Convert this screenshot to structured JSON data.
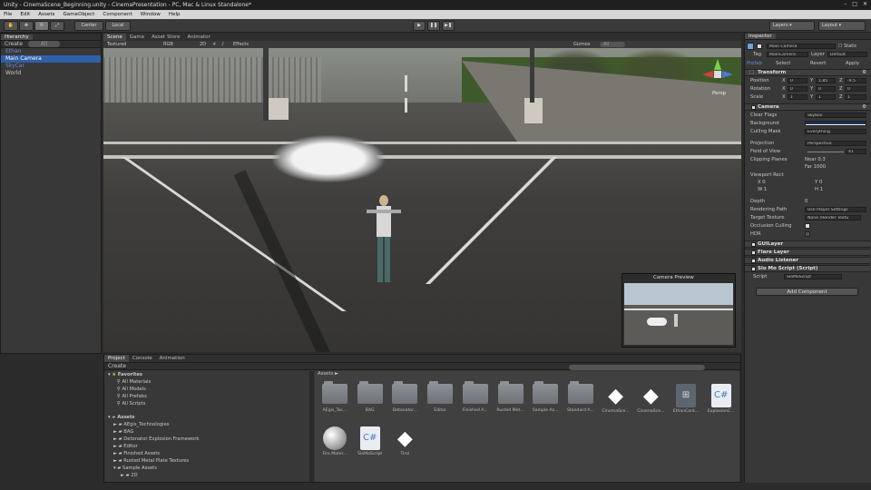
{
  "window": {
    "title": "Unity - CinemaScene_Beginning.unity - CinemaPresentation - PC, Mac & Linux Standalone*",
    "buttons": [
      "–",
      "□",
      "✕"
    ]
  },
  "menu": [
    "File",
    "Edit",
    "Assets",
    "GameObject",
    "Component",
    "Window",
    "Help"
  ],
  "toolbar": {
    "center": "Center",
    "local": "Local",
    "layers": "Layers",
    "layout": "Layout"
  },
  "hierarchy": {
    "tab": "Hierarchy",
    "create": "Create",
    "search": "All",
    "items": [
      {
        "label": "Ethan",
        "type": "prefab"
      },
      {
        "label": "Main Camera",
        "type": "selected"
      },
      {
        "label": "SkyCar",
        "type": "prefab"
      },
      {
        "label": "World",
        "type": "normal"
      }
    ]
  },
  "scene": {
    "tabs": [
      "Scene",
      "Game",
      "Asset Store",
      "Animator"
    ],
    "shading": "Textured",
    "mode": "RGB",
    "dim": "2D",
    "effects": "Effects",
    "gizmos": "Gizmos",
    "gizmo_search": "All",
    "persp": "Persp",
    "preview_title": "Camera Preview"
  },
  "project": {
    "tabs": [
      "Project",
      "Console",
      "Animation"
    ],
    "create": "Create",
    "favorites": "Favorites",
    "fav_items": [
      "All Materials",
      "All Models",
      "All Prefabs",
      "All Scripts"
    ],
    "assets_root": "Assets",
    "tree": [
      "AEgis_Technologies",
      "BAG",
      "Detonator Explosion Framework",
      "Editor",
      "Finished Assets",
      "Rusted Metal Plate Textures",
      "Sample Assets",
      "2D"
    ],
    "crumb": "Assets ►",
    "assets": [
      {
        "name": "AEgis_Tec...",
        "kind": "folder"
      },
      {
        "name": "BAG",
        "kind": "folder"
      },
      {
        "name": "Detonator...",
        "kind": "folder"
      },
      {
        "name": "Editor",
        "kind": "folder"
      },
      {
        "name": "Finished A...",
        "kind": "folder"
      },
      {
        "name": "Rusted Met...",
        "kind": "folder"
      },
      {
        "name": "Sample As...",
        "kind": "folder"
      },
      {
        "name": "Standard A...",
        "kind": "folder"
      },
      {
        "name": "CinemaSce...",
        "kind": "unity"
      },
      {
        "name": "CinemaSce...",
        "kind": "unity"
      },
      {
        "name": "EthanCont...",
        "kind": "controller"
      },
      {
        "name": "ExplosionC...",
        "kind": "script"
      },
      {
        "name": "Fire Mater...",
        "kind": "material"
      },
      {
        "name": "SloMoScript",
        "kind": "script"
      },
      {
        "name": "Tirol",
        "kind": "unity"
      }
    ]
  },
  "inspector": {
    "tab": "Inspector",
    "object_name": "Main Camera",
    "static": "Static",
    "tag_label": "Tag",
    "tag": "MainCamera",
    "layer_label": "Layer",
    "layer": "Default",
    "prefab": "Prefab",
    "select": "Select",
    "revert": "Revert",
    "apply": "Apply",
    "transform": {
      "title": "Transform",
      "position": {
        "label": "Position",
        "x": "0",
        "y": "1.85",
        "z": "-9.5"
      },
      "rotation": {
        "label": "Rotation",
        "x": "0",
        "y": "0",
        "z": "0"
      },
      "scale": {
        "label": "Scale",
        "x": "1",
        "y": "1",
        "z": "1"
      }
    },
    "camera": {
      "title": "Camera",
      "clear_flags": {
        "label": "Clear Flags",
        "value": "Skybox"
      },
      "background": {
        "label": "Background"
      },
      "culling_mask": {
        "label": "Culling Mask",
        "value": "Everything"
      },
      "projection": {
        "label": "Projection",
        "value": "Perspective"
      },
      "fov": {
        "label": "Field of View",
        "value": "41"
      },
      "clipping": {
        "label": "Clipping Planes",
        "near": "Near 0.3",
        "far": "Far  1000"
      },
      "viewport": {
        "label": "Viewport Rect",
        "x": "X 0",
        "y": "Y 0",
        "w": "W 1",
        "h": "H 1"
      },
      "depth": {
        "label": "Depth",
        "value": "0"
      },
      "rendering": {
        "label": "Rendering Path",
        "value": "Use Player Settings"
      },
      "target": {
        "label": "Target Texture",
        "value": "None (Render Textu"
      },
      "occlusion": {
        "label": "Occlusion Culling"
      },
      "hdr": {
        "label": "HDR"
      }
    },
    "components": [
      "GUILayer",
      "Flare Layer",
      "Audio Listener",
      "Slo Mo Script (Script)"
    ],
    "script": {
      "label": "Script",
      "value": "SloMoScript"
    },
    "add_component": "Add Component"
  }
}
